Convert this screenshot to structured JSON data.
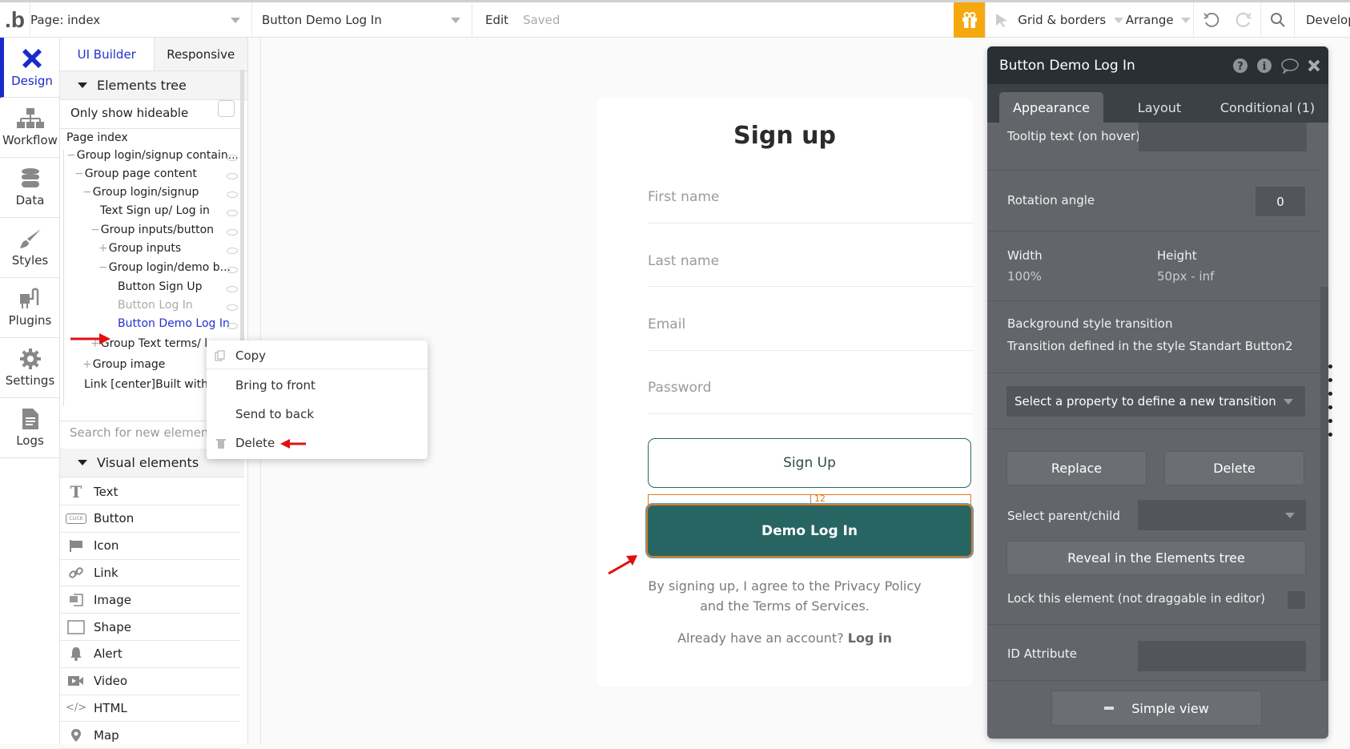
{
  "topbar": {
    "logo": ".b",
    "page_selector": "Page: index",
    "element_selector": "Button Demo Log In",
    "edit_label": "Edit",
    "status": "Saved",
    "grid_borders": "Grid & borders",
    "arrange": "Arrange",
    "develop": "Develop",
    "accent_color": "#f6a80f"
  },
  "rail": {
    "items": [
      {
        "label": "Design",
        "icon": "design-icon"
      },
      {
        "label": "Workflow",
        "icon": "workflow-icon"
      },
      {
        "label": "Data",
        "icon": "database-icon"
      },
      {
        "label": "Styles",
        "icon": "brush-icon"
      },
      {
        "label": "Plugins",
        "icon": "plug-icon"
      },
      {
        "label": "Settings",
        "icon": "gear-icon"
      },
      {
        "label": "Logs",
        "icon": "document-icon"
      }
    ]
  },
  "panel": {
    "tabs": [
      "UI Builder",
      "Responsive"
    ],
    "elements_tree_title": "Elements tree",
    "only_show_hideable": "Only show hideable",
    "tree": [
      {
        "label": "Page index",
        "prefix": ""
      },
      {
        "label": "Group login/signup contain...",
        "prefix": "−"
      },
      {
        "label": "Group page content",
        "prefix": "−"
      },
      {
        "label": "Group login/signup",
        "prefix": "−"
      },
      {
        "label": "Text Sign up/ Log in",
        "prefix": ""
      },
      {
        "label": "Group inputs/button",
        "prefix": "−"
      },
      {
        "label": "Group inputs",
        "prefix": "+"
      },
      {
        "label": "Group login/demo b...",
        "prefix": "−"
      },
      {
        "label": "Button Sign Up",
        "prefix": ""
      },
      {
        "label": "Button Log In",
        "prefix": "",
        "hidden": true
      },
      {
        "label": "Button Demo Log In",
        "prefix": "",
        "selected": true
      },
      {
        "label": "Group Text terms/ lo",
        "prefix": "+"
      },
      {
        "label": "Group image",
        "prefix": "+"
      },
      {
        "label": "Link [center]Built with ❤",
        "prefix": ""
      }
    ],
    "search_placeholder": "Search for new elements...",
    "visual_elements_title": "Visual elements",
    "visual_elements": [
      "Text",
      "Button",
      "Icon",
      "Link",
      "Image",
      "Shape",
      "Alert",
      "Video",
      "HTML",
      "Map"
    ]
  },
  "context_menu": {
    "items": [
      "Copy",
      "Bring to front",
      "Send to back",
      "Delete"
    ]
  },
  "canvas": {
    "title": "Sign up",
    "fields": [
      "First name",
      "Last name",
      "Email",
      "Password"
    ],
    "signup_button": "Sign Up",
    "demo_button": "Demo Log In",
    "spacing_label": "12",
    "terms_line1": "By signing up, I agree to the Privacy Policy",
    "terms_line2": "and the Terms of Services.",
    "already": "Already have an account?",
    "login_link": "Log in",
    "brand_color": "#276563"
  },
  "editor": {
    "title": "Button Demo Log In",
    "tabs": [
      "Appearance",
      "Layout",
      "Conditional (1)"
    ],
    "tooltip_label": "Tooltip text (on hover)",
    "rotation_label": "Rotation angle",
    "rotation_value": "0",
    "width_label": "Width",
    "width_value": "100%",
    "height_label": "Height",
    "height_value": "50px - inf",
    "bg_transition_label": "Background style transition",
    "bg_transition_note": "Transition defined in the style Standart Button2",
    "transition_select": "Select a property to define a new transition",
    "replace": "Replace",
    "delete": "Delete",
    "parent_child_label": "Select parent/child",
    "reveal": "Reveal in the Elements tree",
    "lock_label": "Lock this element (not draggable in editor)",
    "id_label": "ID Attribute",
    "simple_view": "Simple view"
  }
}
